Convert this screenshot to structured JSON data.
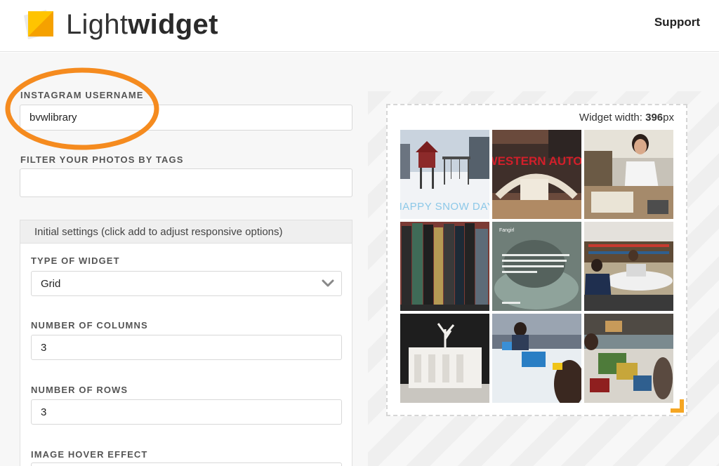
{
  "header": {
    "brand_light": "Light",
    "brand_bold": "widget",
    "support_label": "Support"
  },
  "form": {
    "username_label": "INSTAGRAM USERNAME",
    "username_value": "bvwlibrary",
    "tags_label": "FILTER YOUR PHOTOS BY TAGS",
    "tags_value": "",
    "settings_title": "Initial settings (click add to adjust responsive options)",
    "type_label": "TYPE OF WIDGET",
    "type_value": "Grid",
    "columns_label": "NUMBER OF COLUMNS",
    "columns_value": "3",
    "rows_label": "NUMBER OF ROWS",
    "rows_value": "3",
    "hover_label": "IMAGE HOVER EFFECT"
  },
  "preview": {
    "width_prefix": "Widget width: ",
    "width_value": "396",
    "width_unit": "px",
    "tiles": [
      {
        "name": "snow-playground",
        "caption": "HAPPY SNOW DAY"
      },
      {
        "name": "western-auto-sign",
        "caption": "WESTERN AUTO"
      },
      {
        "name": "student-lab-coat",
        "caption": ""
      },
      {
        "name": "book-spines",
        "caption": ""
      },
      {
        "name": "quote-kitten",
        "caption": "Fangirl"
      },
      {
        "name": "library-study",
        "caption": ""
      },
      {
        "name": "paper-model",
        "caption": ""
      },
      {
        "name": "students-tablets",
        "caption": ""
      },
      {
        "name": "craft-activity",
        "caption": ""
      }
    ]
  },
  "colors": {
    "logo_orange": "#f5a100",
    "annotation_orange": "#f58b1f",
    "handle_orange": "#f5a623"
  },
  "icons": {
    "logo": "lightwidget-logo-icon",
    "dropdown": "chevron-down-icon",
    "resize": "resize-handle-icon"
  }
}
